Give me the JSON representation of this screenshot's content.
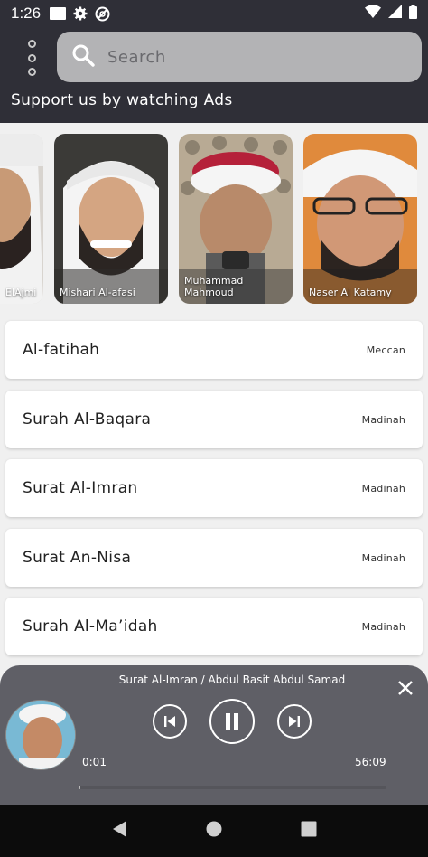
{
  "status_bar": {
    "time": "1:26",
    "icons": [
      "message-icon",
      "gear-icon",
      "do-not-disturb-icon",
      "wifi-icon",
      "signal-icon",
      "battery-icon"
    ]
  },
  "header": {
    "menu_icon": "overflow-menu-icon",
    "search": {
      "placeholder": "Search",
      "value": "",
      "icon": "search-icon"
    },
    "support_text": "Support us by watching Ads"
  },
  "reciters": [
    {
      "name": "ElAjmi"
    },
    {
      "name": "Mishari Al-afasi"
    },
    {
      "name": "Muhammad Mahmoud"
    },
    {
      "name": "Naser Al Katamy"
    }
  ],
  "surahs": [
    {
      "name": "Al-fatihah",
      "type": "Meccan"
    },
    {
      "name": "Surah Al-Baqara",
      "type": "Madinah"
    },
    {
      "name": "Surat Al-Imran",
      "type": "Madinah"
    },
    {
      "name": "Surat An-Nisa",
      "type": "Madinah"
    },
    {
      "name": "Surah Al-Ma’idah",
      "type": "Madinah"
    }
  ],
  "player": {
    "track_title": "Surat Al-Imran / Abdul Basit Abdul Samad",
    "current_time": "0:01",
    "total_time": "56:09",
    "progress": 0.0003,
    "icons": [
      "close-icon",
      "previous-icon",
      "pause-icon",
      "next-icon"
    ]
  },
  "nav_bar": {
    "icons": [
      "back-icon",
      "home-icon",
      "recents-icon"
    ]
  },
  "colors": {
    "header_bg": "#2f2f37",
    "search_bg": "#b3b3b5",
    "page_bg": "#f0f0f0",
    "player_bg": "#5f5f66",
    "nav_bg": "#0c0c0c"
  }
}
